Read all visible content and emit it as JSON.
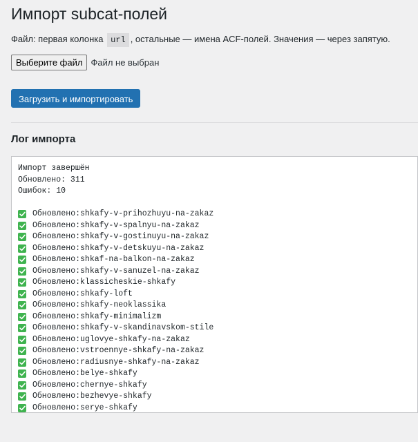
{
  "page": {
    "title": "Импорт subcat-полей",
    "desc_before": "Файл: первая колонка",
    "desc_code": "url",
    "desc_after": ", остальные — имена ACF-полей. Значения — через запятую."
  },
  "file_input": {
    "button_label": "Выберите файл",
    "status": "Файл не выбран"
  },
  "submit_label": "Загрузить и импортировать",
  "log": {
    "heading": "Лог импорта",
    "summary": [
      "Импорт завершён",
      "Обновлено: 311",
      "Ошибок: 10"
    ],
    "entry_prefix": "Обновлено:",
    "entries": [
      "shkafy-v-prihozhuyu-na-zakaz",
      "shkafy-v-spalnyu-na-zakaz",
      "shkafy-v-gostinuyu-na-zakaz",
      "shkafy-v-detskuyu-na-zakaz",
      "shkaf-na-balkon-na-zakaz",
      "shkafy-v-sanuzel-na-zakaz",
      "klassicheskie-shkafy",
      "shkafy-loft",
      "shkafy-neoklassika",
      "shkafy-minimalizm",
      "shkafy-v-skandinavskom-stile",
      "uglovye-shkafy-na-zakaz",
      "vstroennye-shkafy-na-zakaz",
      "radiusnye-shkafy-na-zakaz",
      "belye-shkafy",
      "chernye-shkafy",
      "bezhevye-shkafy",
      "serye-shkafy"
    ],
    "check_icon": "check-mark-icon",
    "check_color": "#3fb34f"
  },
  "colors": {
    "primary": "#2271b1",
    "background": "#f0f0f1"
  }
}
